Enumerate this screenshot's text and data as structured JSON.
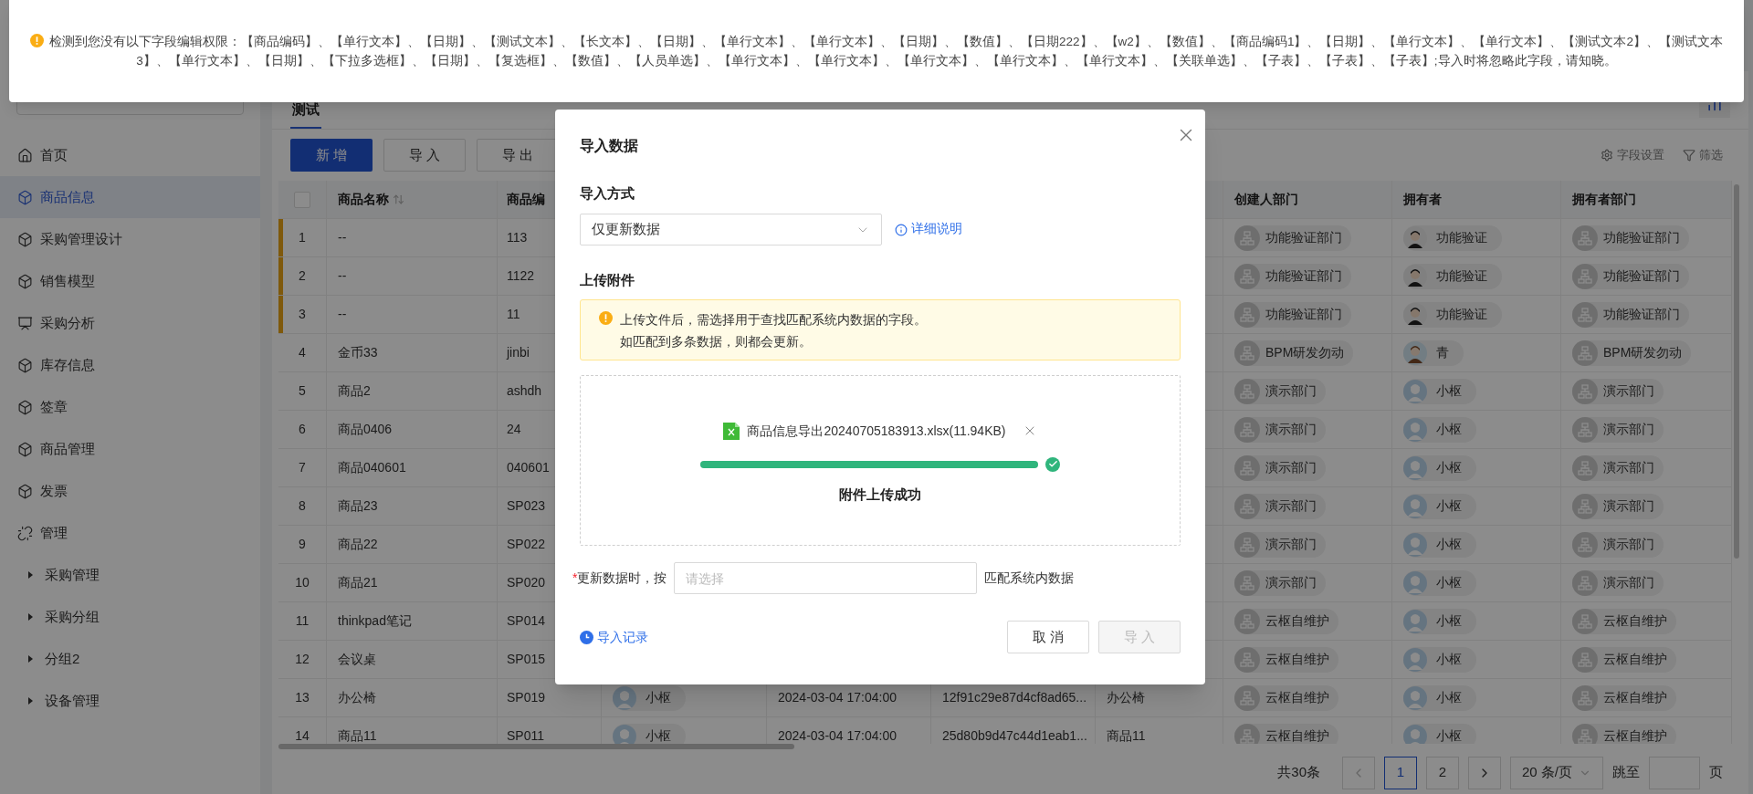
{
  "notification": {
    "text": "检测到您没有以下字段编辑权限：【商品编码】、【单行文本】、【日期】、【测试文本】、【长文本】、【日期】、【单行文本】、【单行文本】、【日期】、【数值】、【日期222】、【w2】、【数值】、【商品编码1】、【日期】、【单行文本】、【单行文本】、【测试文本2】、【测试文本3】、【单行文本】、【日期】、【下拉多选框】、【日期】、【复选框】、【数值】、【人员单选】、【单行文本】、【单行文本】、【单行文本】、【单行文本】、【单行文本】、【关联单选】、【子表】、【子表】、【子表】;导入时将忽略此字段，请知晓。"
  },
  "sidebar": {
    "items": [
      {
        "label": "首页",
        "kind": "home",
        "selected": false
      },
      {
        "label": "商品信息",
        "kind": "app",
        "selected": true
      },
      {
        "label": "采购管理设计",
        "kind": "app",
        "selected": false
      },
      {
        "label": "销售模型",
        "kind": "app",
        "selected": false
      },
      {
        "label": "采购分析",
        "kind": "report",
        "selected": false
      },
      {
        "label": "库存信息",
        "kind": "app",
        "selected": false
      },
      {
        "label": "签章",
        "kind": "app",
        "selected": false
      },
      {
        "label": "商品管理",
        "kind": "app",
        "selected": false
      },
      {
        "label": "发票",
        "kind": "app",
        "selected": false
      },
      {
        "label": "管理",
        "kind": "group",
        "selected": false,
        "children": [
          {
            "label": "采购管理",
            "expanded": false
          },
          {
            "label": "采购分组",
            "expanded": false
          },
          {
            "label": "分组2",
            "expanded": false
          },
          {
            "label": "设备管理",
            "expanded": false
          }
        ]
      }
    ]
  },
  "tabs": [
    {
      "label": "测试",
      "selected": true
    }
  ],
  "toolbar": {
    "buttons": [
      {
        "label": "新 增",
        "kind": "primary"
      },
      {
        "label": "导 入",
        "kind": "default"
      },
      {
        "label": "导 出",
        "kind": "default"
      }
    ],
    "field_settings": "字段设置",
    "filter": "筛选"
  },
  "table": {
    "select_all": {
      "checked": false
    },
    "columns": [
      {
        "label": "商品名称",
        "sortable": true
      },
      {
        "label": "商品编",
        "sortable": false
      },
      {
        "label": "创建人部门",
        "sortable": false
      },
      {
        "label": "拥有者",
        "sortable": false
      },
      {
        "label": "拥有者部门",
        "sortable": false
      }
    ],
    "rows": [
      {
        "index": "1",
        "flagged": true,
        "name": "--",
        "code": "113",
        "creator_dept": "功能验证部门",
        "owner": {
          "name": "功能验证",
          "kind": "male"
        },
        "owner_dept": "功能验证部门"
      },
      {
        "index": "2",
        "flagged": true,
        "name": "--",
        "code": "1122",
        "creator_dept": "功能验证部门",
        "owner": {
          "name": "功能验证",
          "kind": "male"
        },
        "owner_dept": "功能验证部门"
      },
      {
        "index": "3",
        "flagged": true,
        "name": "--",
        "code": "11",
        "creator_dept": "功能验证部门",
        "owner": {
          "name": "功能验证",
          "kind": "male"
        },
        "owner_dept": "功能验证部门"
      },
      {
        "index": "4",
        "flagged": false,
        "name": "金币33",
        "code": "jinbi",
        "creator_dept": "BPM研发勿动",
        "owner": {
          "name": "青",
          "kind": "female"
        },
        "owner_dept": "BPM研发勿动"
      },
      {
        "index": "5",
        "flagged": false,
        "name": "商品2",
        "code": "ashdh",
        "creator_dept": "演示部门",
        "owner": {
          "name": "小枢",
          "kind": "default"
        },
        "owner_dept": "演示部门"
      },
      {
        "index": "6",
        "flagged": false,
        "name": "商品0406",
        "code": "24",
        "creator_dept": "演示部门",
        "owner": {
          "name": "小枢",
          "kind": "default"
        },
        "owner_dept": "演示部门"
      },
      {
        "index": "7",
        "flagged": false,
        "name": "商品040601",
        "code": "040601",
        "creator_dept": "演示部门",
        "owner": {
          "name": "小枢",
          "kind": "default"
        },
        "owner_dept": "演示部门"
      },
      {
        "index": "8",
        "flagged": false,
        "name": "商品23",
        "code": "SP023",
        "creator_dept": "演示部门",
        "owner": {
          "name": "小枢",
          "kind": "default"
        },
        "owner_dept": "演示部门"
      },
      {
        "index": "9",
        "flagged": false,
        "name": "商品22",
        "code": "SP022",
        "creator_dept": "演示部门",
        "owner": {
          "name": "小枢",
          "kind": "default"
        },
        "owner_dept": "演示部门"
      },
      {
        "index": "10",
        "flagged": false,
        "name": "商品21",
        "code": "SP020",
        "creator_dept": "演示部门",
        "owner": {
          "name": "小枢",
          "kind": "default"
        },
        "owner_dept": "演示部门"
      },
      {
        "index": "11",
        "flagged": false,
        "name": "thinkpad笔记",
        "code": "SP014",
        "creator_dept": "云枢自维护",
        "owner": {
          "name": "小枢",
          "kind": "default"
        },
        "owner_dept": "云枢自维护"
      },
      {
        "index": "12",
        "flagged": false,
        "name": "会议桌",
        "code": "SP015",
        "creator_dept": "云枢自维护",
        "owner": {
          "name": "小枢",
          "kind": "default"
        },
        "owner_dept": "云枢自维护"
      },
      {
        "index": "13",
        "flagged": false,
        "name": "办公椅",
        "code": "SP019",
        "column_4": {
          "name": "小枢",
          "kind": "default"
        },
        "column_5": "2024-03-04 17:04:00",
        "column_6": "12f91c29e87d4cf8ad65...",
        "column_7": "办公椅",
        "creator_dept": "云枢自维护",
        "owner": {
          "name": "小枢",
          "kind": "default"
        },
        "owner_dept": "云枢自维护"
      },
      {
        "index": "14",
        "flagged": false,
        "name": "商品11",
        "code": "SP011",
        "column_4": {
          "name": "小枢",
          "kind": "default"
        },
        "column_5": "2024-03-04 17:04:00",
        "column_6": "25d80b9d47c44d1eab1...",
        "column_7": "商品11",
        "creator_dept": "云枢自维护",
        "owner": {
          "name": "小枢",
          "kind": "default"
        },
        "owner_dept": "云枢自维护"
      }
    ]
  },
  "pagination": {
    "total": "共30条",
    "pages": [
      {
        "label": "1",
        "selected": true
      },
      {
        "label": "2",
        "selected": false
      }
    ],
    "page_size": "20 条/页",
    "jump_label": "跳至",
    "page_unit": "页"
  },
  "modal": {
    "title": "导入数据",
    "method_label": "导入方式",
    "method_value": "仅更新数据",
    "help_link": "详细说明",
    "upload_label": "上传附件",
    "notice": [
      "上传文件后，需选择用于查找匹配系统内数据的字段。",
      "如匹配到多条数据，则都会更新。"
    ],
    "file": {
      "name": "商品信息导出20240705183913.xlsx(11.94KB)",
      "level": 1,
      "status": "附件上传成功"
    },
    "match": {
      "required": true,
      "required_mark": "*",
      "label": "更新数据时，按",
      "placeholder": "请选择",
      "suffix": "匹配系统内数据"
    },
    "history_link": "导入记录",
    "buttons": [
      {
        "label": "取 消",
        "disabled": false
      },
      {
        "label": "导 入",
        "disabled": true
      }
    ]
  }
}
